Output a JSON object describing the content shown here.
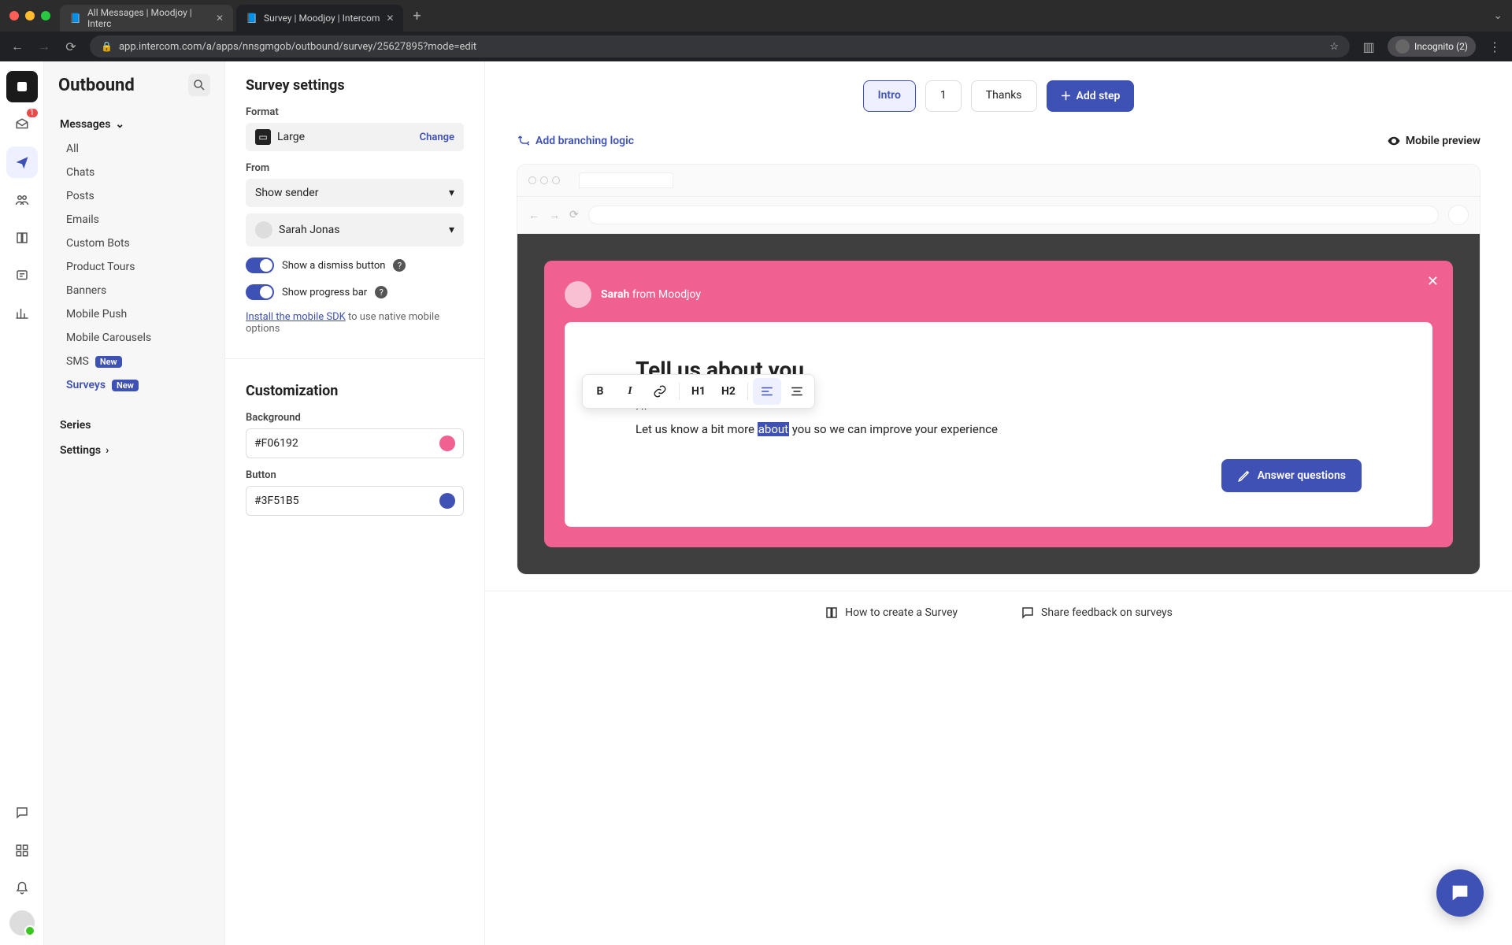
{
  "browser": {
    "tabs": [
      {
        "title": "All Messages | Moodjoy | Interc",
        "active": false
      },
      {
        "title": "Survey | Moodjoy | Intercom",
        "active": true
      }
    ],
    "url": "app.intercom.com/a/apps/nnsgmgob/outbound/survey/25627895?mode=edit",
    "incognito": "Incognito (2)"
  },
  "iconrail": {
    "inbox_badge": "1"
  },
  "sidebar": {
    "title": "Outbound",
    "section_messages": "Messages",
    "items": {
      "all": "All",
      "chats": "Chats",
      "posts": "Posts",
      "emails": "Emails",
      "custom_bots": "Custom Bots",
      "product_tours": "Product Tours",
      "banners": "Banners",
      "mobile_push": "Mobile Push",
      "mobile_carousels": "Mobile Carousels",
      "sms": "SMS",
      "surveys": "Surveys"
    },
    "new_badge": "New",
    "series": "Series",
    "settings": "Settings"
  },
  "settings": {
    "heading": "Survey settings",
    "format_label": "Format",
    "format_value": "Large",
    "change": "Change",
    "from_label": "From",
    "show_sender": "Show sender",
    "sender_name": "Sarah Jonas",
    "dismiss_label": "Show a dismiss button",
    "progress_label": "Show progress bar",
    "sdk_link": "Install the mobile SDK",
    "sdk_rest": " to use native mobile options",
    "customization": "Customization",
    "background_label": "Background",
    "background_value": "#F06192",
    "button_label": "Button",
    "button_value": "#3F51B5"
  },
  "steps": {
    "intro": "Intro",
    "one": "1",
    "thanks": "Thanks",
    "add": "Add step"
  },
  "canvas": {
    "branching": "Add branching logic",
    "preview": "Mobile preview"
  },
  "survey": {
    "from_name": "Sarah",
    "from_suffix": " from Moodjoy",
    "title": "Tell us about you",
    "greeting": "Hi",
    "text_before": "Let us know a bit more ",
    "text_highlight": "about",
    "text_after": " you so we can improve your experience",
    "button": "Answer questions"
  },
  "toolbar": {
    "b": "B",
    "i": "I",
    "h1": "H1",
    "h2": "H2"
  },
  "footer": {
    "howto": "How to create a Survey",
    "feedback": "Share feedback on surveys"
  }
}
